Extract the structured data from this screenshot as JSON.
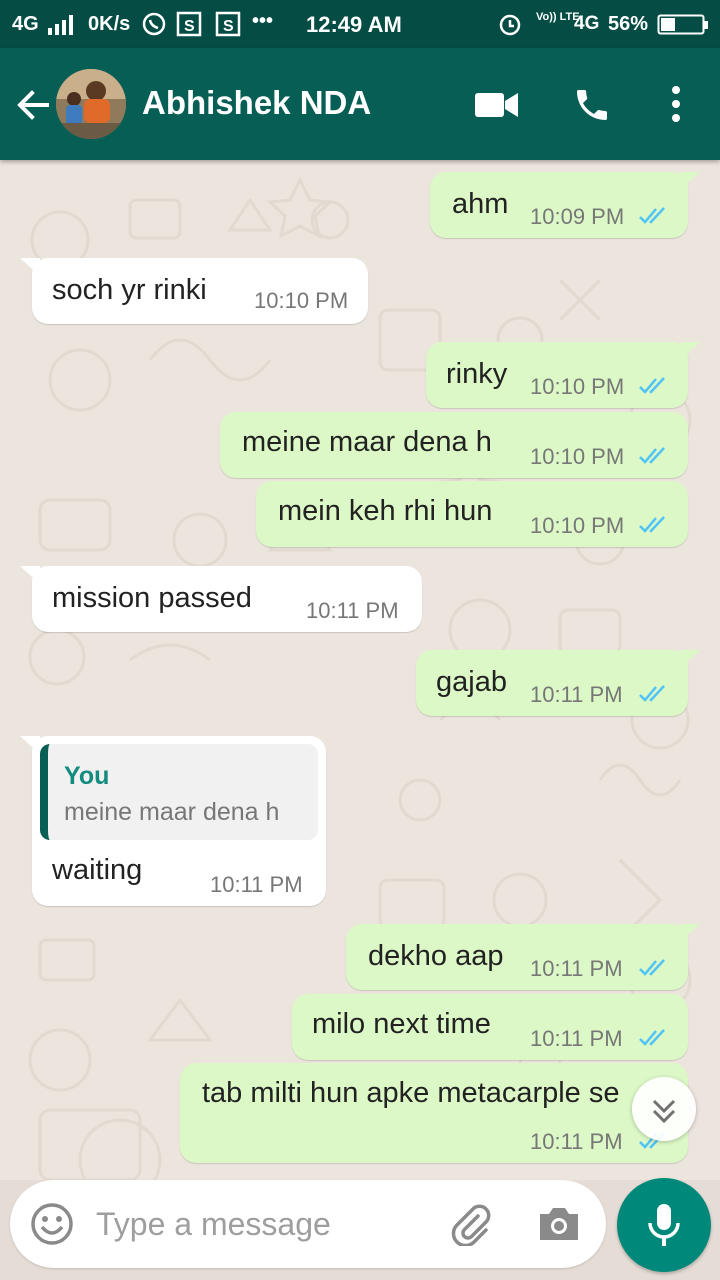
{
  "status_bar": {
    "network_left": "4G",
    "speed": "0K/s",
    "time": "12:49 AM",
    "dots": "•••",
    "volte": "Vo)) LTE",
    "network_right": "4G",
    "battery": "56%"
  },
  "header": {
    "contact_name": "Abhishek NDA"
  },
  "messages": [
    {
      "dir": "out",
      "text": "ahm",
      "time": "10:09 PM"
    },
    {
      "dir": "in",
      "text": "soch yr rinki",
      "time": "10:10 PM"
    },
    {
      "dir": "out",
      "text": "rinky",
      "time": "10:10 PM"
    },
    {
      "dir": "out",
      "text": "meine maar dena h",
      "time": "10:10 PM"
    },
    {
      "dir": "out",
      "text": "mein keh rhi hun",
      "time": "10:10 PM"
    },
    {
      "dir": "in",
      "text": "mission passed",
      "time": "10:11 PM"
    },
    {
      "dir": "out",
      "text": "gajab",
      "time": "10:11 PM"
    },
    {
      "dir": "in",
      "text": "waiting",
      "time": "10:11 PM",
      "quote_author": "You",
      "quote_text": "meine maar dena h"
    },
    {
      "dir": "out",
      "text": "dekho aap",
      "time": "10:11 PM"
    },
    {
      "dir": "out",
      "text": "milo next time",
      "time": "10:11 PM"
    },
    {
      "dir": "out",
      "text": "tab milti hun apke metacarple se",
      "time": "10:11 PM"
    }
  ],
  "composer": {
    "placeholder": "Type a message"
  },
  "colors": {
    "header": "#075e54",
    "status_bar": "#054d44",
    "outgoing_bubble": "#dcf8c6",
    "incoming_bubble": "#ffffff",
    "read_ticks": "#4fc3f7",
    "mic_button": "#00897b"
  },
  "icons": [
    "back-arrow-icon",
    "video-call-icon",
    "phone-icon",
    "more-vert-icon",
    "emoji-icon",
    "attach-icon",
    "camera-icon",
    "mic-icon",
    "scroll-down-icon",
    "read-ticks-icon"
  ]
}
